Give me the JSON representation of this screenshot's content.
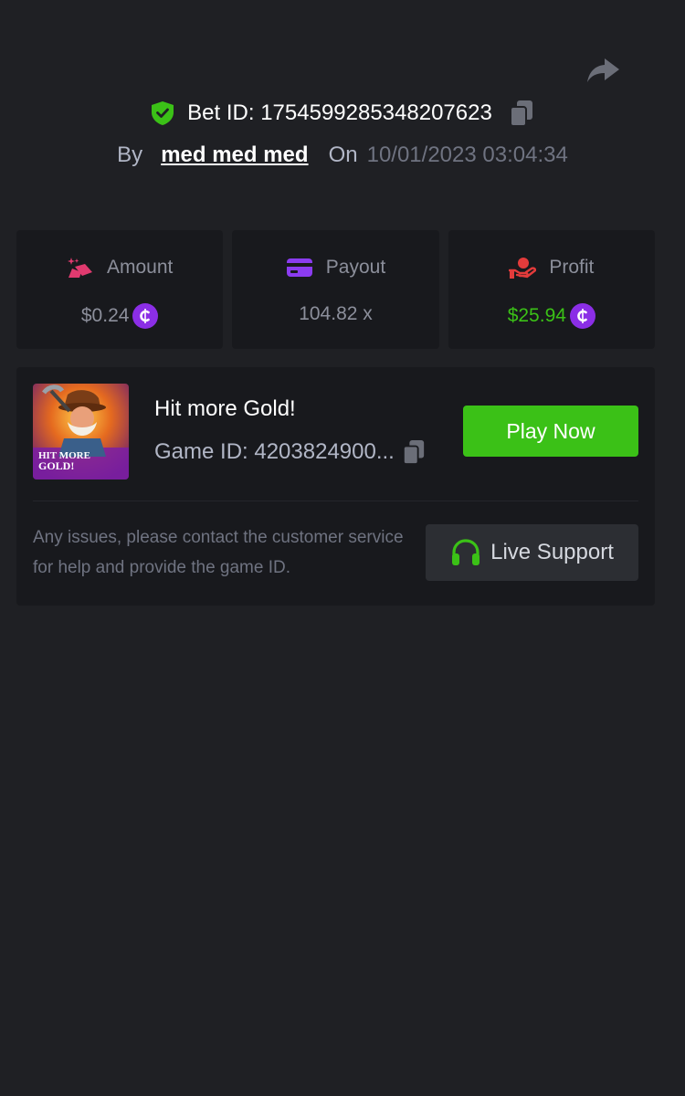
{
  "header": {
    "share_icon": "share-icon",
    "bet_id_label": "Bet ID: 1754599285348207623",
    "by_label": "By",
    "username": "med med med",
    "on_label": "On",
    "datetime": "10/01/2023 03:04:34"
  },
  "stats": [
    {
      "label": "Amount",
      "value": "$0.24",
      "icon": "amount-icon",
      "icon_color": "#e03a6f",
      "has_coin": true
    },
    {
      "label": "Payout",
      "value": "104.82 x",
      "icon": "card-icon",
      "icon_color": "#8b3cf0",
      "has_coin": false
    },
    {
      "label": "Profit",
      "value": "$25.94",
      "icon": "profit-icon",
      "icon_color": "#e33b3b",
      "has_coin": true,
      "value_color": "#3bc117"
    }
  ],
  "game": {
    "title": "Hit more Gold!",
    "game_id": "Game ID: 4203824900...",
    "thumb_text_line1": "HIT MORE",
    "thumb_text_line2": "GOLD!",
    "play_label": "Play Now"
  },
  "support": {
    "text": "Any issues, please contact the customer service for help and provide the game ID.",
    "button_label": "Live Support"
  },
  "colors": {
    "background": "#1f2024",
    "card": "#18191d",
    "accent_green": "#3bc117",
    "coin_purple": "#8b2ee6"
  }
}
